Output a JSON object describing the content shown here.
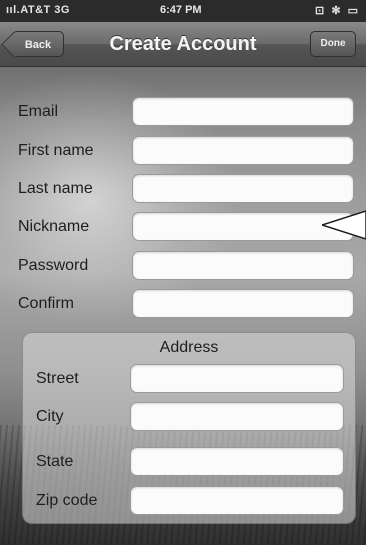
{
  "status": {
    "carrier": "AT&T 3G",
    "time": "6:47 PM"
  },
  "nav": {
    "back_label": "Back",
    "title": "Create Account",
    "done_label": "Done"
  },
  "fields": [
    {
      "label": "Email",
      "value": ""
    },
    {
      "label": "First name",
      "value": ""
    },
    {
      "label": "Last name",
      "value": ""
    },
    {
      "label": "Nickname",
      "value": ""
    },
    {
      "label": "Password",
      "value": ""
    },
    {
      "label": "Confirm",
      "value": ""
    }
  ],
  "address": {
    "title": "Address",
    "fields": [
      {
        "label": "Street",
        "value": ""
      },
      {
        "label": "City",
        "value": ""
      },
      {
        "label": "State",
        "value": ""
      },
      {
        "label": "Zip code",
        "value": ""
      }
    ]
  }
}
